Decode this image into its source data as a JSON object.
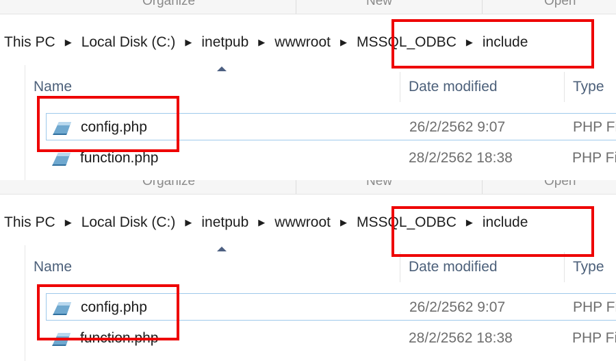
{
  "ribbon": {
    "groups": [
      "Organize",
      "New",
      "Open"
    ]
  },
  "breadcrumb": [
    "This PC",
    "Local Disk (C:)",
    "inetpub",
    "wwwroot",
    "MSSQL_ODBC",
    "include"
  ],
  "columns": {
    "name": "Name",
    "date": "Date modified",
    "type": "Type"
  },
  "files": [
    {
      "name": "config.php",
      "date": "26/2/2562 9:07",
      "type": "PHP Fi"
    },
    {
      "name": "function.php",
      "date": "28/2/2562 18:38",
      "type": "PHP Fi"
    }
  ],
  "colors": {
    "highlight": "#ee0000",
    "selection_border": "#9ec9eb",
    "header_text": "#4c607a"
  },
  "icons": [
    "chevron-right-icon",
    "sort-ascending-icon",
    "php-file-icon"
  ]
}
